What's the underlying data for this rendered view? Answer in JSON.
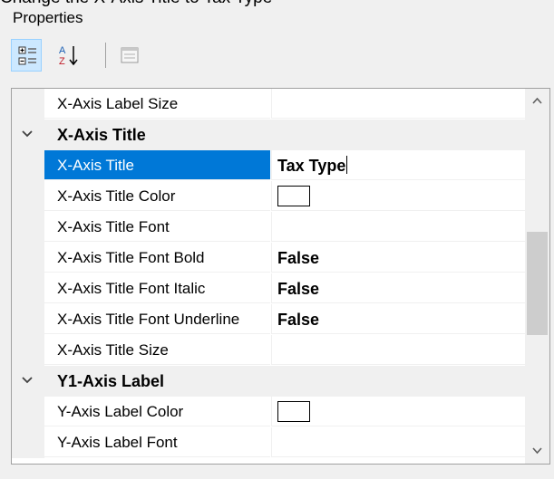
{
  "cutoff_text": "Change the X-Axis Title to Tax Type",
  "panel": {
    "title": "Properties"
  },
  "toolbar": {
    "buttons": [
      {
        "icon": "categorized-icon",
        "active": true
      },
      {
        "icon": "sort-alphabetical-icon",
        "active": false
      },
      {
        "icon": "property-pages-icon",
        "active": false
      }
    ]
  },
  "grid": {
    "rows": [
      {
        "type": "property",
        "name": "X-Axis Label Size",
        "value": ""
      },
      {
        "type": "category",
        "name": "X-Axis Title"
      },
      {
        "type": "property",
        "name": "X-Axis Title",
        "value": "Tax Type",
        "selected": true,
        "bold": true,
        "editing": true
      },
      {
        "type": "property",
        "name": "X-Axis Title Color",
        "value": "",
        "swatch": "#ffffff"
      },
      {
        "type": "property",
        "name": "X-Axis Title Font",
        "value": ""
      },
      {
        "type": "property",
        "name": "X-Axis Title Font Bold",
        "value": "False",
        "bold": true
      },
      {
        "type": "property",
        "name": "X-Axis Title Font Italic",
        "value": "False",
        "bold": true
      },
      {
        "type": "property",
        "name": "X-Axis Title Font Underline",
        "value": "False",
        "bold": true
      },
      {
        "type": "property",
        "name": "X-Axis Title Size",
        "value": ""
      },
      {
        "type": "category",
        "name": "Y1-Axis Label"
      },
      {
        "type": "property",
        "name": "Y-Axis Label Color",
        "value": "",
        "swatch": "#ffffff"
      },
      {
        "type": "property",
        "name": "Y-Axis Label Font",
        "value": ""
      }
    ]
  },
  "colors": {
    "selection": "#0078d7",
    "panel_bg": "#f0f0f0",
    "grid_bg": "#ffffff"
  }
}
